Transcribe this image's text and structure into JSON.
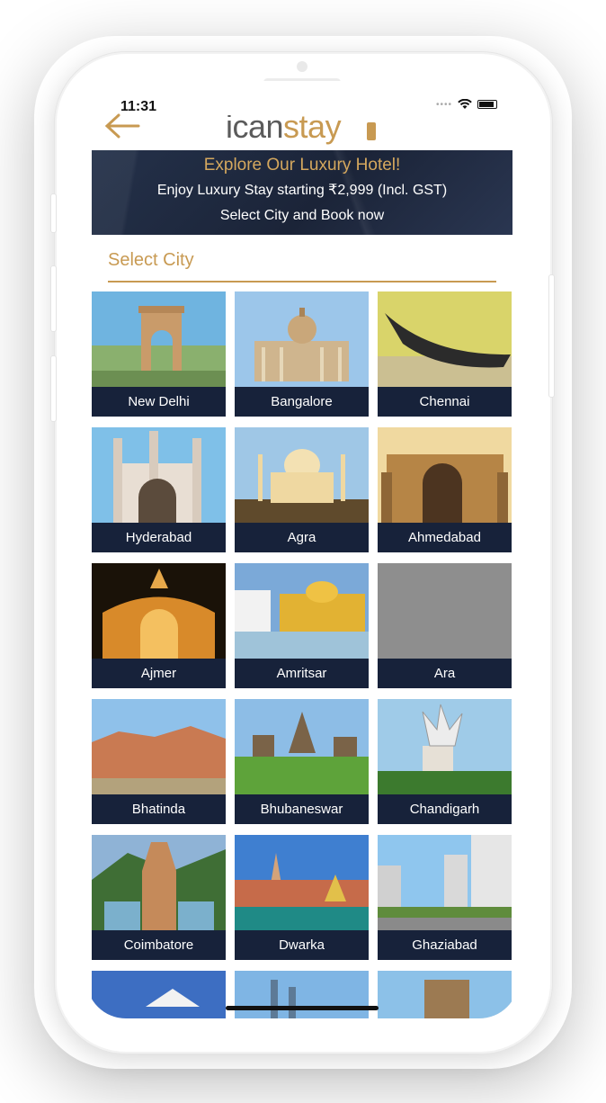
{
  "status_bar": {
    "time": "11:31"
  },
  "header": {
    "logo_part1": "ican",
    "logo_part2": "stay"
  },
  "banner": {
    "title": "Explore Our Luxury Hotel!",
    "line1": "Enjoy Luxury Stay starting ₹2,999 (Incl. GST)",
    "line2": "Select City and Book now"
  },
  "city_select": {
    "placeholder": "Select City"
  },
  "cities": [
    {
      "name": "New Delhi"
    },
    {
      "name": "Bangalore"
    },
    {
      "name": "Chennai"
    },
    {
      "name": "Hyderabad"
    },
    {
      "name": "Agra"
    },
    {
      "name": "Ahmedabad"
    },
    {
      "name": "Ajmer"
    },
    {
      "name": "Amritsar"
    },
    {
      "name": "Ara"
    },
    {
      "name": "Bhatinda"
    },
    {
      "name": "Bhubaneswar"
    },
    {
      "name": "Chandigarh"
    },
    {
      "name": "Coimbatore"
    },
    {
      "name": "Dwarka"
    },
    {
      "name": "Ghaziabad"
    }
  ],
  "theme": {
    "accent": "#c89a52",
    "navy": "#17223a"
  }
}
